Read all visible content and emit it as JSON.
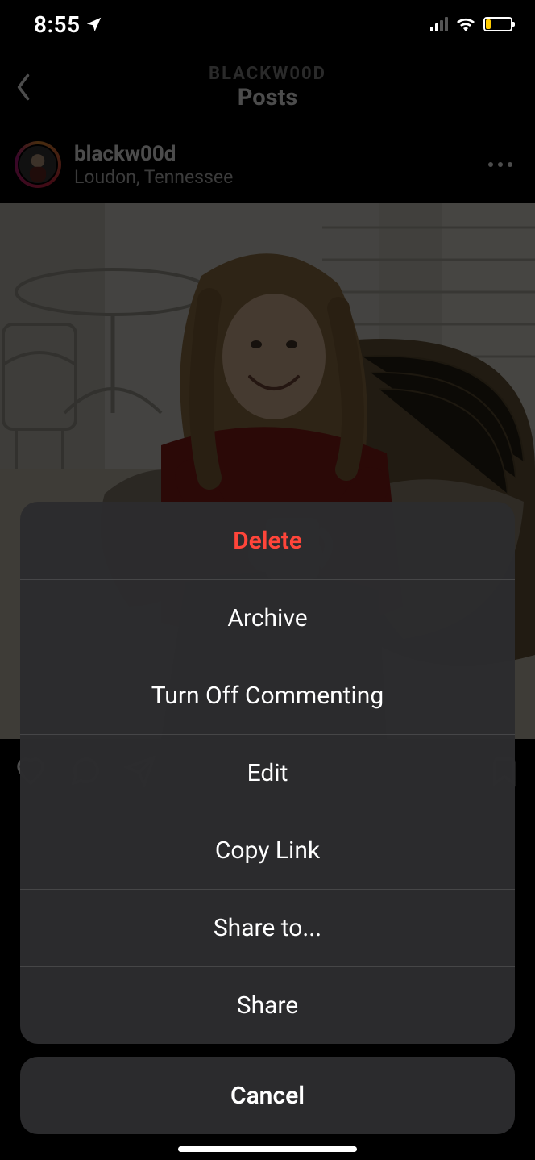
{
  "status_bar": {
    "time": "8:55"
  },
  "nav": {
    "username_upper": "BLACKW00D",
    "title": "Posts"
  },
  "post": {
    "username": "blackw00d",
    "location": "Loudon, Tennessee"
  },
  "action_sheet": {
    "delete": "Delete",
    "archive": "Archive",
    "turn_off_commenting": "Turn Off Commenting",
    "edit": "Edit",
    "copy_link": "Copy Link",
    "share_to": "Share to...",
    "share": "Share",
    "cancel": "Cancel"
  }
}
